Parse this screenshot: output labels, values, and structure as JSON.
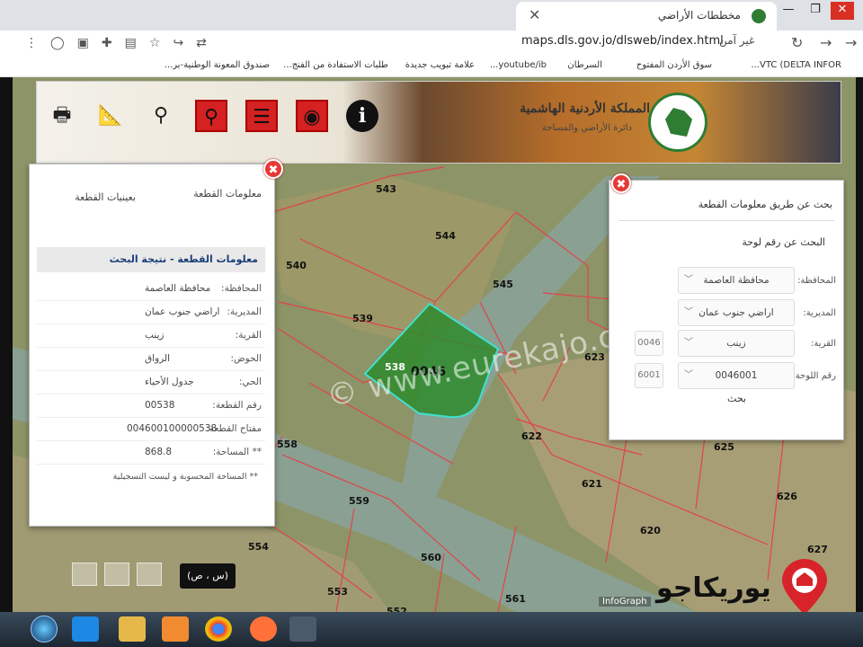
{
  "browser": {
    "tab_title": "مخططات الأراضي",
    "url": "maps.dls.gov.jo/dlsweb/index.html",
    "security": "غير آمن",
    "new_tab": "+",
    "bookmarks": [
      "VTC (DELTA INFOR...",
      "سوق الأردن المفتوح",
      "السرطان",
      "youtube/ib...",
      "علامة تبويب جديدة",
      "طلبات الاستفادة من الفنج...",
      "صندوق المعونة الوطنية-بر..."
    ]
  },
  "header": {
    "kingdom": "المملكة الأردنية الهاشمية",
    "department": "دائرة الأراضي والمساحة",
    "tools": [
      "printer-icon",
      "measure-icon",
      "zoom-search-icon",
      "search-icon",
      "report-icon",
      "location-pin-icon",
      "info-icon"
    ],
    "info_glyph": "i"
  },
  "left_panel": {
    "close": "✖",
    "tab_parcel_info": "معلومات القطعة",
    "tab_samples": "بعينيات القطعة",
    "title": "معلومات القطعة - نتيجة البحث",
    "rows": [
      {
        "label": "المحافظة:",
        "value": "محافظة العاصمة"
      },
      {
        "label": "المديرية:",
        "value": "اراضي جنوب عمان"
      },
      {
        "label": "القرية:",
        "value": "زينب"
      },
      {
        "label": "الحوض:",
        "value": "الرواق"
      },
      {
        "label": "الحي:",
        "value": "جدول الأحياء"
      },
      {
        "label": "رقم القطعة:",
        "value": "00538"
      },
      {
        "label": "مفتاح القطعة:",
        "value": "004600100000538"
      },
      {
        "label": "** المساحة:",
        "value": "868.8"
      }
    ],
    "note": "** المساحة المحسوبة و ليست التسجيلية"
  },
  "right_panel": {
    "close": "✖",
    "title": "بحث عن طريق معلومات القطعة",
    "subtitle": "البحث عن رقم لوحة",
    "fields": [
      {
        "label": "المحافظة:",
        "value": "محافظة العاصمة",
        "code": ""
      },
      {
        "label": "المديرية:",
        "value": "اراضي جنوب عمان",
        "code": ""
      },
      {
        "label": "القرية:",
        "value": "زينب",
        "code": "0046"
      },
      {
        "label": "رقم اللوحة:",
        "value": "0046001",
        "code": "6001"
      }
    ],
    "search": "بحث"
  },
  "map": {
    "highlight_label": "0046",
    "parcels": [
      "543",
      "544",
      "540",
      "545",
      "539",
      "538",
      "623",
      "622",
      "625",
      "558",
      "621",
      "626",
      "559",
      "620",
      "554",
      "560",
      "553",
      "552",
      "561",
      "627"
    ],
    "coord_button": "(س ، ص)",
    "infograph": "InfoGraph",
    "watermark": "© www.eurekajo.com",
    "brand": "يوريكاجو"
  },
  "colors": {
    "highlight_fill": "#2e8b2e",
    "highlight_stroke": "#40e0d0",
    "parcel_line": "#e0444a",
    "close_red": "#e53935"
  }
}
